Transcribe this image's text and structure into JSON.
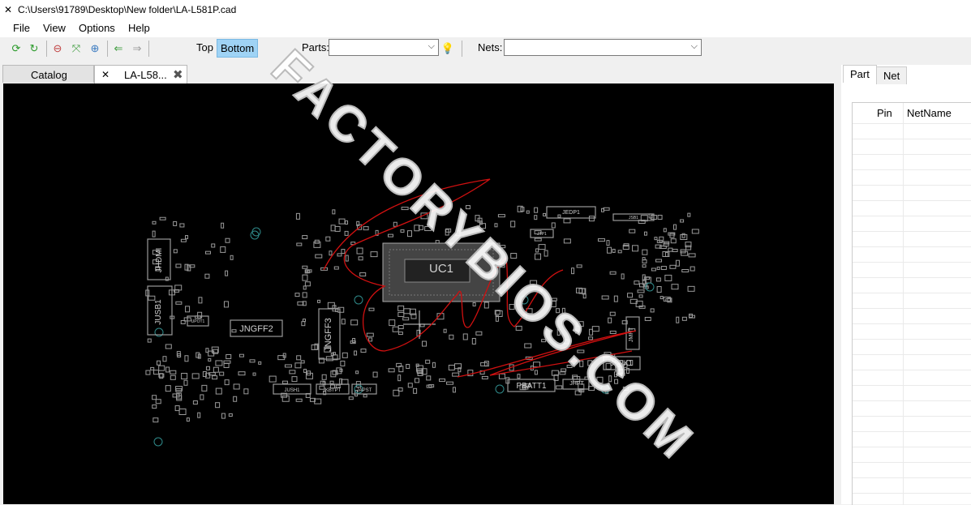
{
  "window": {
    "title": "C:\\Users\\91789\\Desktop\\New folder\\LA-L581P.cad",
    "app_icon": "crossed-arrows-icon"
  },
  "menu": [
    "File",
    "View",
    "Options",
    "Help"
  ],
  "toolbar": {
    "icons": [
      "refresh-green-icon",
      "rotate-green-icon",
      "zoom-out-icon",
      "fit-view-icon",
      "zoom-in-icon",
      "back-arrow-icon",
      "forward-arrow-icon"
    ],
    "side_top": "Top",
    "side_bottom": "Bottom",
    "parts_label": "Parts:",
    "parts_value": "",
    "nets_label": "Nets:",
    "nets_value": "",
    "bulb_icon": "lightbulb-icon"
  },
  "tabs": [
    {
      "label": "Catalog"
    },
    {
      "label": "LA-L58...",
      "icon": "crossed-arrows-icon",
      "close_icon": "close-icon"
    }
  ],
  "board": {
    "labels": [
      "UC1",
      "JHDMI",
      "JUSB1",
      "JNGFF2",
      "JNGFF3",
      "PBATT1",
      "JHPT",
      "JUSH1",
      "JKBTPT",
      "JAPST",
      "JSPK1",
      "JEDP1",
      "UPOT1",
      "JTP1",
      "JSB1",
      "JMPT"
    ],
    "accent": "#9a9a9a",
    "annotation_color": "#d01010"
  },
  "watermark": "FACTORYBIOS.COM",
  "right_panel": {
    "tabs": [
      "Part",
      "Net"
    ],
    "columns": [
      "Pin",
      "NetName"
    ]
  }
}
